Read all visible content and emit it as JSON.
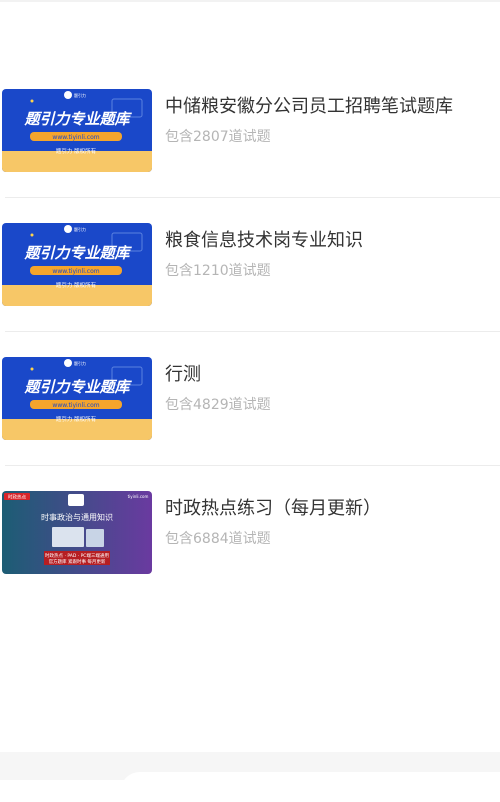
{
  "items": [
    {
      "title": "中储粮安徽分公司员工招聘笔试题库",
      "count": "包含2807道试题",
      "thumb": "brand"
    },
    {
      "title": "粮食信息技术岗专业知识",
      "count": "包含1210道试题",
      "thumb": "brand"
    },
    {
      "title": "行测",
      "count": "包含4829道试题",
      "thumb": "brand"
    },
    {
      "title": "时政热点练习（每月更新）",
      "count": "包含6884道试题",
      "thumb": "news"
    }
  ],
  "thumb_brand": {
    "logo_label": "题引力",
    "headline": "题引力专业题库",
    "url": "www.tiyinli.com",
    "copyright": "题引力 版权所有"
  },
  "thumb_news": {
    "badge": "时政热点",
    "site": "tiyinli.com",
    "headline": "时事政治与通用知识",
    "line1": "时政热点 · PAD · PC端三端通用",
    "line2": "官方题库 紧跟时事 每月更新"
  },
  "colors": {
    "brand_blue": "#1a48c9",
    "brand_orange": "#f5a52c",
    "news_purple": "#6a3aa0",
    "news_teal": "#1c5d74"
  }
}
